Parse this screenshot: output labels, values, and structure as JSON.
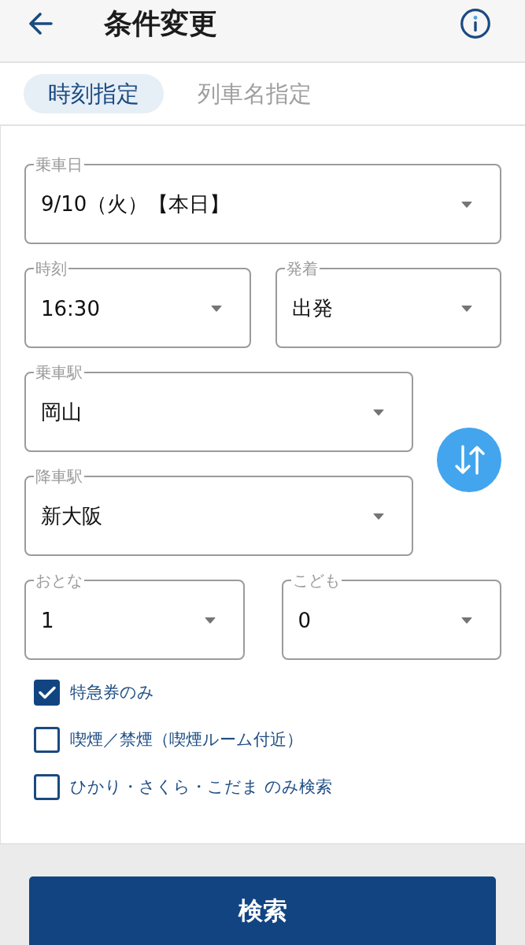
{
  "header": {
    "title": "条件変更"
  },
  "tabs": [
    {
      "label": "時刻指定",
      "selected": true
    },
    {
      "label": "列車名指定",
      "selected": false
    }
  ],
  "boarding_date": {
    "label": "乗車日",
    "value": "9/10（火）【本日】"
  },
  "time_fields": [
    {
      "label": "時刻",
      "value": "16:30"
    },
    {
      "label": "発着",
      "value": "出発"
    }
  ],
  "station_fields": [
    {
      "label": "乗車駅",
      "value": "岡山"
    },
    {
      "label": "降車駅",
      "value": "新大阪"
    }
  ],
  "passenger_fields": [
    {
      "label": "おとな",
      "value": "1"
    },
    {
      "label": "こども",
      "value": "0"
    }
  ],
  "options": [
    {
      "label": "特急券のみ",
      "checked": true
    },
    {
      "label": "喫煙／禁煙（喫煙ルーム付近）",
      "checked": false
    },
    {
      "label": "ひかり・さくら・こだま のみ検索",
      "checked": false
    }
  ],
  "search_button": {
    "label": "検索"
  }
}
